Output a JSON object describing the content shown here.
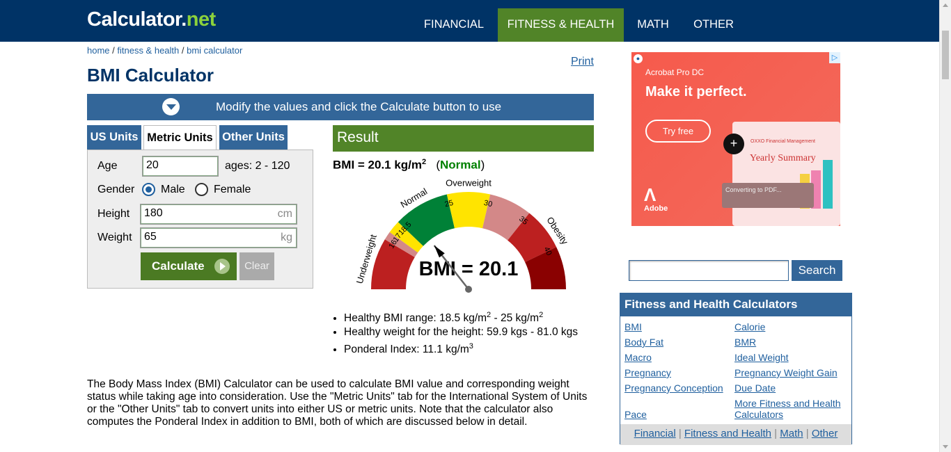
{
  "header": {
    "logo_main": "Calculator",
    "logo_dot": ".",
    "logo_net": "net",
    "nav": [
      "FINANCIAL",
      "FITNESS & HEALTH",
      "MATH",
      "OTHER"
    ]
  },
  "breadcrumb": {
    "home": "home",
    "sep": " / ",
    "fitness": "fitness & health",
    "bmi": "bmi calculator"
  },
  "print_label": "Print",
  "title": "BMI Calculator",
  "modify_text": "Modify the values and click the Calculate button to use",
  "tabs": [
    "US Units",
    "Metric Units",
    "Other Units"
  ],
  "form": {
    "age_label": "Age",
    "age_value": "20",
    "age_hint": "ages: 2 - 120",
    "gender_label": "Gender",
    "male_label": "Male",
    "female_label": "Female",
    "gender_selected": "Male",
    "height_label": "Height",
    "height_value": "180",
    "height_unit": "cm",
    "weight_label": "Weight",
    "weight_value": "65",
    "weight_unit": "kg",
    "calculate_label": "Calculate",
    "clear_label": "Clear"
  },
  "result": {
    "heading": "Result",
    "bmi_text": "BMI = 20.1 kg/m",
    "bmi_sup": "2",
    "open_paren": "(",
    "classification": "Normal",
    "close_paren": ")",
    "gauge_value_text": "BMI = 20.1",
    "gauge_value": 20.1,
    "gauge_labels": [
      "Underweight",
      "Normal",
      "Overweight",
      "Obesity"
    ],
    "gauge_ticks": [
      "16",
      "17",
      "18.5",
      "25",
      "30",
      "35",
      "40"
    ],
    "bullets": [
      {
        "text": "Healthy BMI range: 18.5 kg/m",
        "sup": "2",
        "tail": " - 25 kg/m",
        "sup2": "2"
      },
      {
        "text": "Healthy weight for the height: 59.9 kgs - 81.0 kgs"
      },
      {
        "text": "Ponderal Index: 11.1 kg/m",
        "sup": "3"
      }
    ]
  },
  "intro": "The Body Mass Index (BMI) Calculator can be used to calculate BMI value and corresponding weight status while taking age into consideration. Use the \"Metric Units\" tab for the International System of Units or the \"Other Units\" tab to convert units into either US or metric units. Note that the calculator also computes the Ponderal Index in addition to BMI, both of which are discussed below in detail.",
  "ad": {
    "sub": "Acrobat Pro DC",
    "headline": "Make it perfect.",
    "cta": "Try free",
    "card_small": "OXXO Financial Management",
    "card_title": "Yearly Summary",
    "converting": "Converting to PDF...",
    "brand": "Adobe"
  },
  "search": {
    "value": "",
    "button": "Search"
  },
  "side": {
    "title": "Fitness and Health Calculators",
    "left": [
      "BMI",
      "Body Fat",
      "Macro",
      "Pregnancy",
      "Pregnancy Conception",
      "Pace"
    ],
    "right": [
      "Calorie",
      "BMR",
      "Ideal Weight",
      "Pregnancy Weight Gain",
      "Due Date",
      "More Fitness and Health Calculators"
    ],
    "footer": [
      "Financial",
      "Fitness and Health",
      "Math",
      "Other"
    ],
    "sep": " | "
  },
  "colors": {
    "header": "#003366",
    "active_nav": "#518428",
    "accent_blue": "#336699",
    "gauge_red": "#bc2020",
    "gauge_pink": "#d38888",
    "gauge_yellow": "#ffe400",
    "gauge_green": "#008137",
    "gauge_darkred": "#8a0101"
  }
}
